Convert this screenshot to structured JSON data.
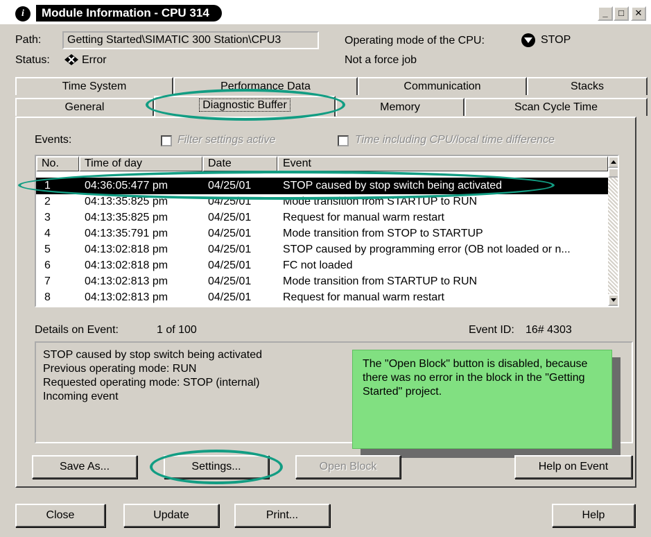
{
  "window": {
    "title": "Module Information - CPU 314",
    "min": "_",
    "max": "□",
    "close": "✕"
  },
  "info": {
    "path_label": "Path:",
    "path_value": "Getting Started\\SIMATIC 300 Station\\CPU3",
    "mode_label": "Operating mode of the  CPU:",
    "mode_value": "STOP",
    "status_label": "Status:",
    "status_value": "Error",
    "force_text": "Not a force job"
  },
  "tabs_row1": [
    "Time System",
    "Performance Data",
    "Communication",
    "Stacks"
  ],
  "tabs_row2": [
    "General",
    "Diagnostic Buffer",
    "Memory",
    "Scan Cycle Time"
  ],
  "events": {
    "label": "Events:",
    "filter_label": "Filter settings active",
    "time_label": "Time including CPU/local time difference",
    "columns": [
      "No.",
      "Time of day",
      "Date",
      "Event"
    ],
    "rows": [
      {
        "no": "1",
        "time": "04:36:05:477 pm",
        "date": "04/25/01",
        "event": "STOP caused by stop switch being activated"
      },
      {
        "no": "2",
        "time": "04:13:35:825 pm",
        "date": "04/25/01",
        "event": "Mode transition from STARTUP to RUN"
      },
      {
        "no": "3",
        "time": "04:13:35:825 pm",
        "date": "04/25/01",
        "event": "Request for manual warm restart"
      },
      {
        "no": "4",
        "time": "04:13:35:791 pm",
        "date": "04/25/01",
        "event": "Mode transition from STOP to STARTUP"
      },
      {
        "no": "5",
        "time": "04:13:02:818 pm",
        "date": "04/25/01",
        "event": "STOP caused by programming error (OB not loaded or n..."
      },
      {
        "no": "6",
        "time": "04:13:02:818 pm",
        "date": "04/25/01",
        "event": "FC not loaded"
      },
      {
        "no": "7",
        "time": "04:13:02:813 pm",
        "date": "04/25/01",
        "event": "Mode transition from STARTUP to RUN"
      },
      {
        "no": "8",
        "time": "04:13:02:813 pm",
        "date": "04/25/01",
        "event": "Request for manual warm restart"
      }
    ]
  },
  "details": {
    "label": "Details on Event:",
    "position": "1 of 100",
    "event_id_label": "Event ID:",
    "event_id_value": "16# 4303",
    "lines": [
      "STOP caused by stop switch being activated",
      "Previous operating mode: RUN",
      "Requested operating mode: STOP (internal)",
      "Incoming event"
    ]
  },
  "note": "The \"Open Block\" button is disabled, because there was no error in the block in the \"Getting Started\" project.",
  "buttons": {
    "save_as": "Save As...",
    "settings": "Settings...",
    "open_block": "Open Block",
    "help_on_event": "Help on Event",
    "close": "Close",
    "update": "Update",
    "print": "Print...",
    "help": "Help"
  },
  "colors": {
    "highlight": "#129d83",
    "note_bg": "#81e081",
    "dialog_bg": "#d4d0c8"
  }
}
